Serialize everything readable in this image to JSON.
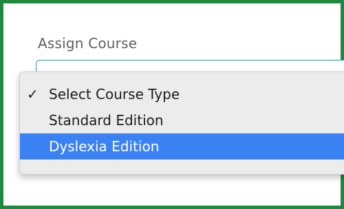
{
  "form": {
    "label": "Assign Course"
  },
  "dropdown": {
    "check_glyph": "✓",
    "options": [
      {
        "label": "Select Course Type",
        "selected": true,
        "highlighted": false
      },
      {
        "label": "Standard Edition",
        "selected": false,
        "highlighted": false
      },
      {
        "label": "Dyslexia Edition",
        "selected": false,
        "highlighted": true
      }
    ]
  },
  "colors": {
    "frame_border": "#1f8a3f",
    "select_border": "#27a3a3",
    "highlight": "#3a82f4",
    "menu_background": "#ececec"
  }
}
